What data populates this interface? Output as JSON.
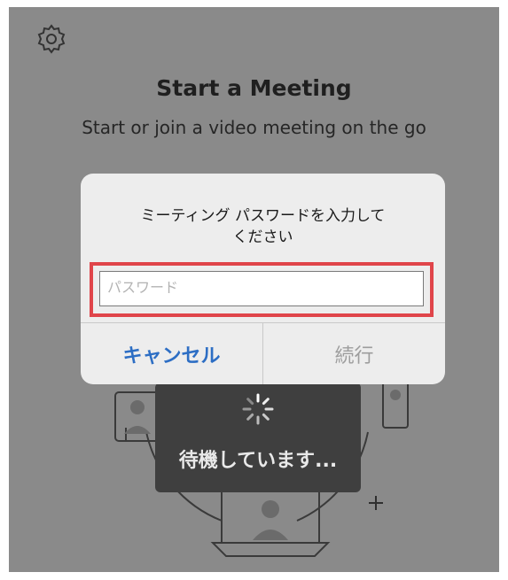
{
  "header": {
    "title": "Start a Meeting",
    "subtitle": "Start or join a video meeting on the go"
  },
  "dialog": {
    "message_line1": "ミーティング パスワードを入力して",
    "message_line2": "ください",
    "password_placeholder": "パスワード",
    "password_value": "",
    "cancel_label": "キャンセル",
    "continue_label": "続行"
  },
  "overlay": {
    "waiting_text": "待機しています..."
  },
  "icons": {
    "settings": "gear-icon",
    "spinner": "spinner-icon"
  },
  "colors": {
    "accent": "#2d6ec4",
    "highlight": "#e0454a",
    "disabled": "#9d9d9d"
  }
}
